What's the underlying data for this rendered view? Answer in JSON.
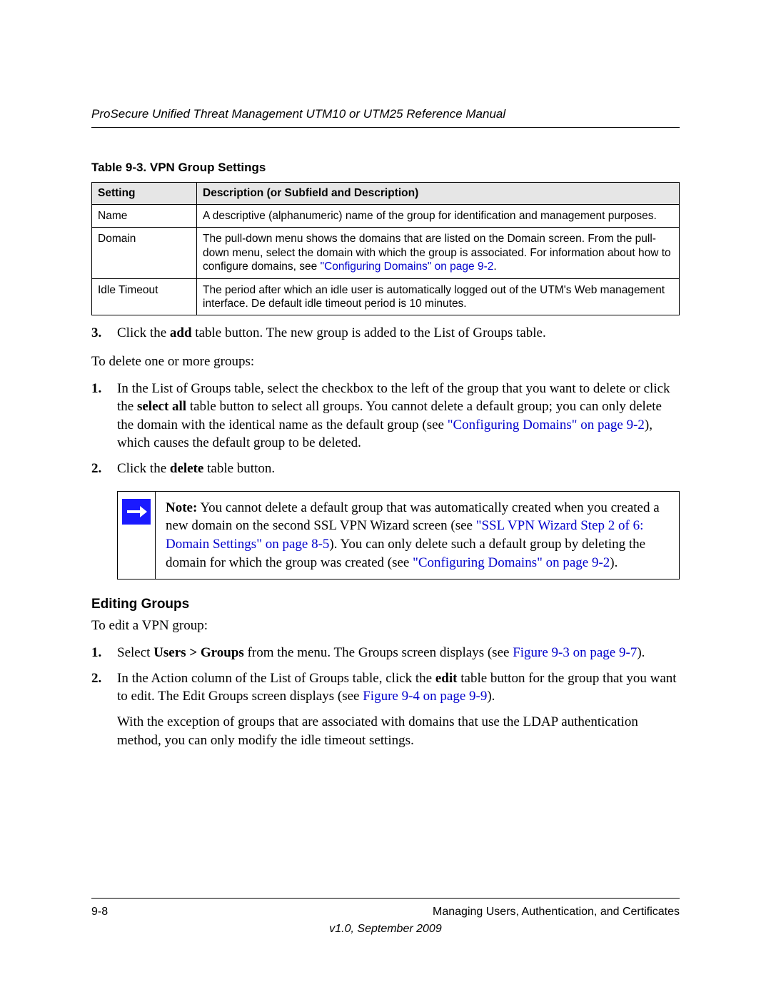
{
  "header": {
    "title": "ProSecure Unified Threat Management UTM10 or UTM25 Reference Manual"
  },
  "table": {
    "caption": "Table 9-3. VPN Group Settings",
    "headers": {
      "setting": "Setting",
      "description": "Description (or Subfield and Description)"
    },
    "rows": [
      {
        "setting": "Name",
        "desc": "A descriptive (alphanumeric) name of the group for identification and management purposes."
      },
      {
        "setting": "Domain",
        "desc_pre": "The pull-down menu shows the domains that are listed on the Domain screen. From the pull-down menu, select the domain with which the group is associated. For information about how to configure domains, see ",
        "link": "\"Configuring Domains\" on page 9-2",
        "desc_post": "."
      },
      {
        "setting": "Idle Timeout",
        "desc": "The period after which an idle user is automatically logged out of the UTM's Web management interface. De default idle timeout period is 10 minutes."
      }
    ]
  },
  "step3": {
    "num": "3.",
    "pre": "Click the ",
    "bold": "add",
    "post": " table button. The new group is added to the List of Groups table."
  },
  "delete_intro": "To delete one or more groups:",
  "delete_steps": {
    "s1": {
      "num": "1.",
      "t1": "In the List of Groups table, select the checkbox to the left of the group that you want to delete or click the ",
      "b1": "select all",
      "t2": " table button to select all groups. You cannot delete a default group; you can only delete the domain with the identical name as the default group (see ",
      "link": "\"Configuring Domains\" on page 9-2",
      "t3": "), which causes the default group to be deleted."
    },
    "s2": {
      "num": "2.",
      "t1": "Click the ",
      "b1": "delete",
      "t2": " table button."
    }
  },
  "note": {
    "b": "Note:",
    "t1": " You cannot delete a default group that was automatically created when you created a new domain on the second SSL VPN Wizard screen (see ",
    "link1": "\"SSL VPN Wizard Step 2 of 6: Domain Settings\" on page 8-5",
    "t2": "). You can only delete such a default group by deleting the domain for which the group was created (see ",
    "link2": "\"Configuring Domains\" on page 9-2",
    "t3": ")."
  },
  "editing": {
    "heading": "Editing Groups",
    "intro": "To edit a VPN group:",
    "s1": {
      "num": "1.",
      "t1": "Select ",
      "b1": "Users > Groups",
      "t2": " from the menu. The Groups screen displays (see ",
      "link": "Figure 9-3 on page 9-7",
      "t3": ")."
    },
    "s2": {
      "num": "2.",
      "t1": "In the Action column of the List of Groups table, click the ",
      "b1": "edit",
      "t2": " table button for the group that you want to edit. The Edit Groups screen displays (see ",
      "link": "Figure 9-4 on page 9-9",
      "t3": ")."
    },
    "para": "With the exception of groups that are associated with domains that use the LDAP authentication method, you can only modify the idle timeout settings."
  },
  "footer": {
    "page": "9-8",
    "chapter": "Managing Users, Authentication, and Certificates",
    "version": "v1.0, September 2009"
  }
}
